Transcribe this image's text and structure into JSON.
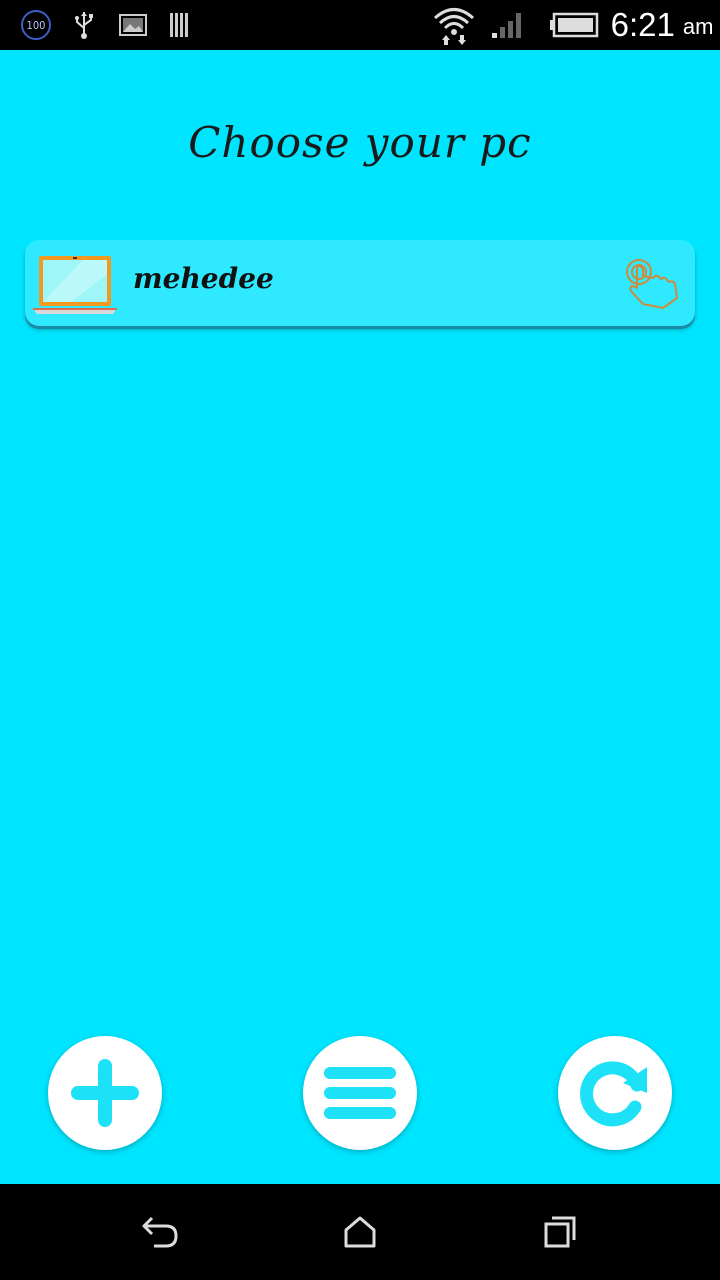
{
  "status_bar": {
    "badge": "100",
    "time": "6:21",
    "ampm": "am",
    "icons": [
      "usb-icon",
      "image-notification-icon",
      "barcode-icon",
      "wifi-icon",
      "cell-signal-icon",
      "battery-icon"
    ]
  },
  "title": "Choose your pc",
  "pc_list": [
    {
      "name": "mehedee",
      "icon": "laptop-icon",
      "action_icon": "tap-hand-icon"
    }
  ],
  "actions": [
    {
      "name": "add",
      "icon": "plus-icon"
    },
    {
      "name": "menu",
      "icon": "menu-icon"
    },
    {
      "name": "refresh",
      "icon": "refresh-icon"
    }
  ],
  "nav": [
    "back-icon",
    "home-icon",
    "recent-apps-icon"
  ],
  "colors": {
    "background": "#00e5ff",
    "item_background": "#2ee9ff",
    "accent": "#1de2f7",
    "laptop_frame": "#f29a1f"
  }
}
